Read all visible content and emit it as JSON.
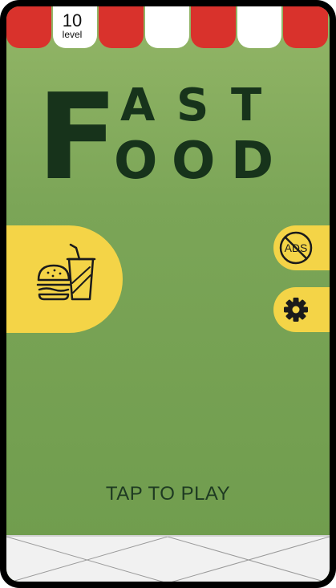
{
  "level": {
    "number": "10",
    "label": "level"
  },
  "title": {
    "line1": [
      "F",
      "A",
      "S",
      "T"
    ],
    "line2": [
      "F",
      "O",
      "O",
      "D"
    ]
  },
  "buttons": {
    "shop_icon": "burger-drink-icon",
    "no_ads_icon": "no-ads-icon",
    "no_ads_text": "ADS",
    "settings_icon": "gear-icon"
  },
  "tap_to_play": "TAP TO PLAY",
  "colors": {
    "background_top": "#93b667",
    "background_bottom": "#6f9c4d",
    "awning_red": "#d9322c",
    "button_yellow": "#f4d447",
    "title_dark": "#17331b"
  }
}
